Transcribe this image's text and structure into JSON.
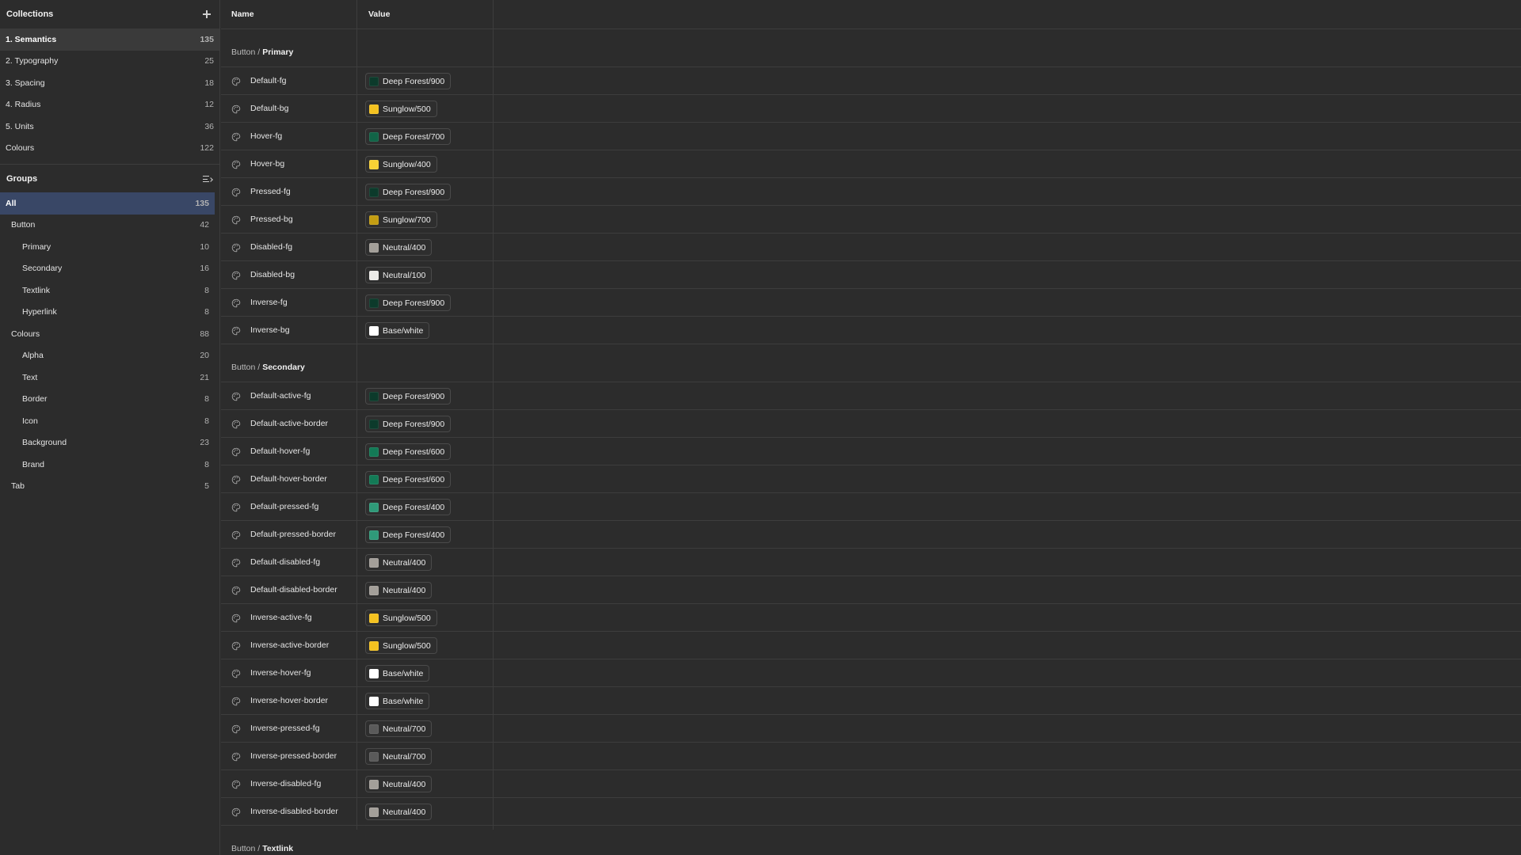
{
  "colors": {
    "Deep Forest/900": "#0c3a2b",
    "Deep Forest/700": "#116447",
    "Deep Forest/600": "#137a56",
    "Deep Forest/400": "#2f9a79",
    "Sunglow/500": "#f4c220",
    "Sunglow/400": "#f7d135",
    "Sunglow/700": "#c39d12",
    "Neutral/400": "#a39f99",
    "Neutral/100": "#ecebe8",
    "Neutral/700": "#5a5a5a",
    "Base/white": "#ffffff"
  },
  "sidebar": {
    "collections_title": "Collections",
    "collections": [
      {
        "label": "1. Semantics",
        "count": "135",
        "active": true
      },
      {
        "label": "2. Typography",
        "count": "25"
      },
      {
        "label": "3. Spacing",
        "count": "18"
      },
      {
        "label": "4. Radius",
        "count": "12"
      },
      {
        "label": "5. Units",
        "count": "36"
      },
      {
        "label": "Colours",
        "count": "122"
      }
    ],
    "groups_title": "Groups",
    "groups": [
      {
        "label": "All",
        "count": "135",
        "level": 0,
        "active": true
      },
      {
        "label": "Button",
        "count": "42",
        "level": 1
      },
      {
        "label": "Primary",
        "count": "10",
        "level": 2
      },
      {
        "label": "Secondary",
        "count": "16",
        "level": 2
      },
      {
        "label": "Textlink",
        "count": "8",
        "level": 2
      },
      {
        "label": "Hyperlink",
        "count": "8",
        "level": 2
      },
      {
        "label": "Colours",
        "count": "88",
        "level": 1
      },
      {
        "label": "Alpha",
        "count": "20",
        "level": 2
      },
      {
        "label": "Text",
        "count": "21",
        "level": 2
      },
      {
        "label": "Border",
        "count": "8",
        "level": 2
      },
      {
        "label": "Icon",
        "count": "8",
        "level": 2
      },
      {
        "label": "Background",
        "count": "23",
        "level": 2
      },
      {
        "label": "Brand",
        "count": "8",
        "level": 2
      },
      {
        "label": "Tab",
        "count": "5",
        "level": 1
      }
    ]
  },
  "table": {
    "col_name": "Name",
    "col_value": "Value",
    "groups": [
      {
        "prefix": "Button /",
        "name": "Primary",
        "rows": [
          {
            "name": "Default-fg",
            "value": "Deep Forest/900"
          },
          {
            "name": "Default-bg",
            "value": "Sunglow/500"
          },
          {
            "name": "Hover-fg",
            "value": "Deep Forest/700"
          },
          {
            "name": "Hover-bg",
            "value": "Sunglow/400"
          },
          {
            "name": "Pressed-fg",
            "value": "Deep Forest/900"
          },
          {
            "name": "Pressed-bg",
            "value": "Sunglow/700"
          },
          {
            "name": "Disabled-fg",
            "value": "Neutral/400"
          },
          {
            "name": "Disabled-bg",
            "value": "Neutral/100"
          },
          {
            "name": "Inverse-fg",
            "value": "Deep Forest/900"
          },
          {
            "name": "Inverse-bg",
            "value": "Base/white"
          }
        ]
      },
      {
        "prefix": "Button /",
        "name": "Secondary",
        "rows": [
          {
            "name": "Default-active-fg",
            "value": "Deep Forest/900"
          },
          {
            "name": "Default-active-border",
            "value": "Deep Forest/900"
          },
          {
            "name": "Default-hover-fg",
            "value": "Deep Forest/600"
          },
          {
            "name": "Default-hover-border",
            "value": "Deep Forest/600"
          },
          {
            "name": "Default-pressed-fg",
            "value": "Deep Forest/400"
          },
          {
            "name": "Default-pressed-border",
            "value": "Deep Forest/400"
          },
          {
            "name": "Default-disabled-fg",
            "value": "Neutral/400"
          },
          {
            "name": "Default-disabled-border",
            "value": "Neutral/400"
          },
          {
            "name": "Inverse-active-fg",
            "value": "Sunglow/500"
          },
          {
            "name": "Inverse-active-border",
            "value": "Sunglow/500"
          },
          {
            "name": "Inverse-hover-fg",
            "value": "Base/white"
          },
          {
            "name": "Inverse-hover-border",
            "value": "Base/white"
          },
          {
            "name": "Inverse-pressed-fg",
            "value": "Neutral/700"
          },
          {
            "name": "Inverse-pressed-border",
            "value": "Neutral/700"
          },
          {
            "name": "Inverse-disabled-fg",
            "value": "Neutral/400"
          },
          {
            "name": "Inverse-disabled-border",
            "value": "Neutral/400"
          }
        ]
      },
      {
        "prefix": "Button /",
        "name": "Textlink",
        "rows": []
      }
    ]
  }
}
